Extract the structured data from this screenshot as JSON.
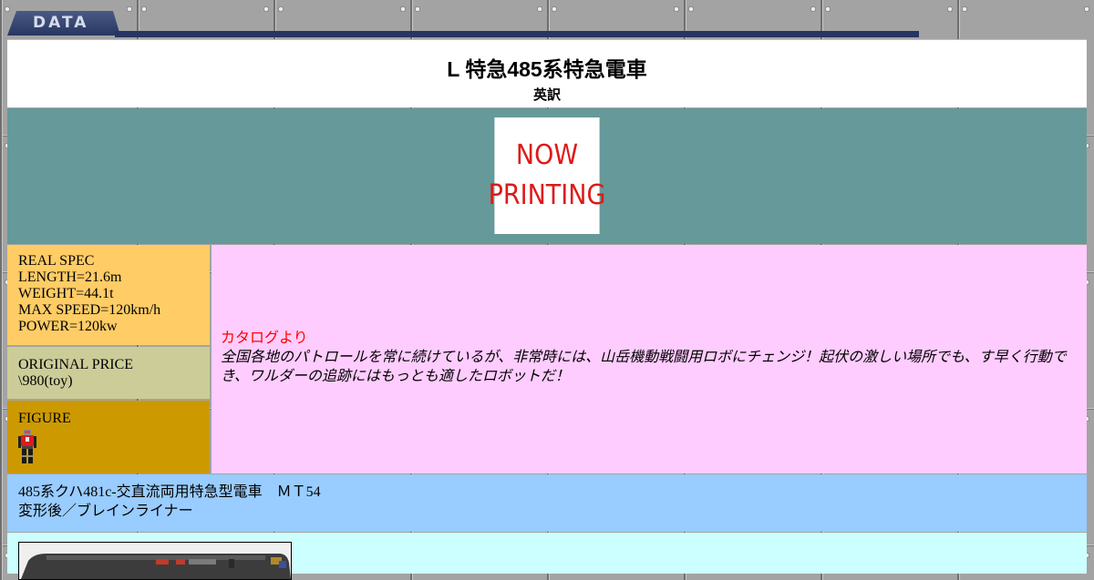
{
  "header": {
    "tab_label": "DATA"
  },
  "title": {
    "main": "L 特急485系特急電車",
    "sub": "英訳"
  },
  "image": {
    "placeholder_line1": "NOW",
    "placeholder_line2": "PRINTING"
  },
  "spec": {
    "heading": "REAL SPEC",
    "length": "LENGTH=21.6m",
    "weight": "WEIGHT=44.1t",
    "max_speed": "MAX SPEED=120km/h",
    "power": "POWER=120kw"
  },
  "price": {
    "heading": "ORIGINAL PRICE",
    "value": "\\980(toy)"
  },
  "figure": {
    "heading": "FIGURE",
    "icon": "robot-figure-icon"
  },
  "catalog": {
    "heading": "カタログより",
    "text": "全国各地のパトロールを常に続けているが、非常時には、山岳機動戦闘用ロボにチェンジ！起伏の激しい場所でも、す早く行動でき、ワルダーの追跡にはもっとも適したロボットだ！"
  },
  "model": {
    "line1": "485系クハ481c-交直流両用特急型電車　ＭＴ54",
    "line2": "変形後／ブレインライナー"
  },
  "colors": {
    "tab_navy": "#283762",
    "title_bg": "#ffffff",
    "image_bg": "#669999",
    "spec_bg": "#ffcc66",
    "price_bg": "#cccc99",
    "figure_bg": "#cc9900",
    "catalog_bg": "#ffccff",
    "catalog_heading": "#ff0000",
    "model_bg": "#99ccff",
    "photo_bg": "#ccffff"
  }
}
